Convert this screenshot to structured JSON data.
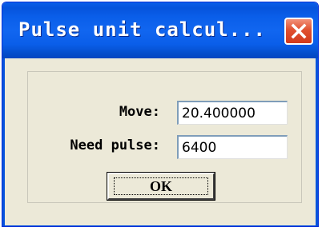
{
  "window": {
    "title": "Pulse unit calcul...",
    "colors": {
      "titlebar": "#0a5ee9",
      "close": "#e0502f",
      "face": "#ece9d8"
    }
  },
  "titlebar": {
    "close_icon": "close-icon"
  },
  "form": {
    "move_label": "Move:",
    "move_value": "20.400000",
    "pulse_label": "Need pulse:",
    "pulse_value": "6400"
  },
  "buttons": {
    "ok_label": "OK"
  }
}
